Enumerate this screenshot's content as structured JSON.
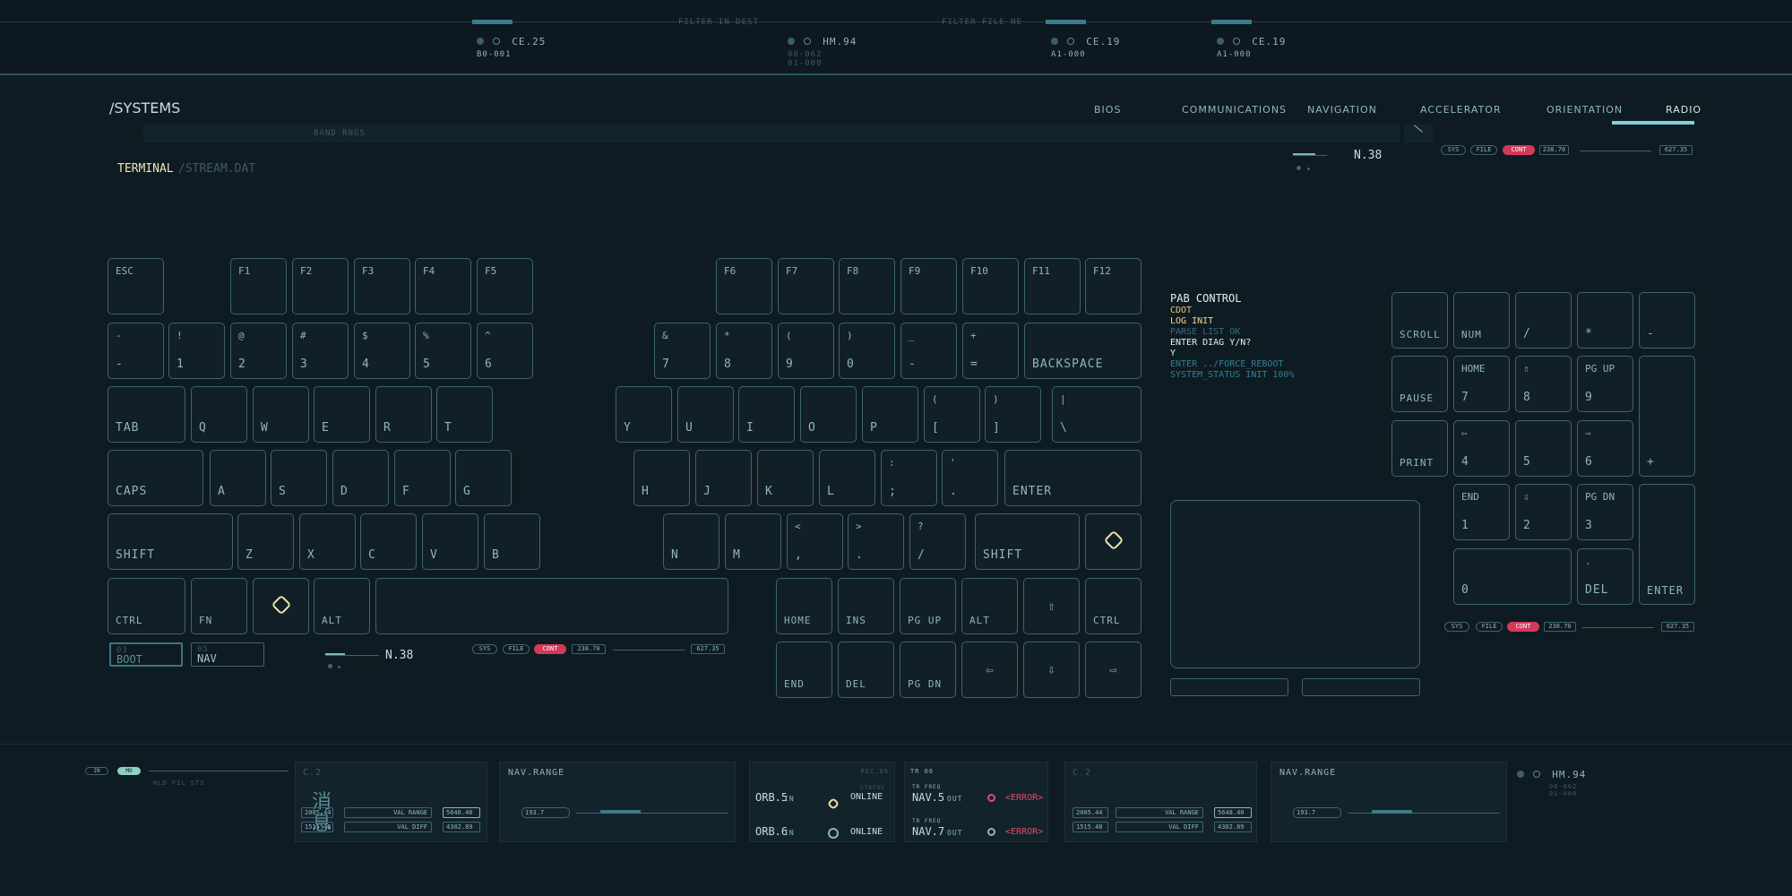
{
  "header": {
    "filter1": "FILTER IN DEST",
    "filter2": "FILTER FILE NE",
    "readouts": [
      {
        "label": "CE.25",
        "sub1": "B0-001",
        "sub2": ""
      },
      {
        "label": "HM.94",
        "sub1": "00-062",
        "sub2": "01-000"
      },
      {
        "label": "CE.19",
        "sub1": "A1-000",
        "sub2": ""
      },
      {
        "label": "CE.19",
        "sub1": "A1-000",
        "sub2": ""
      }
    ]
  },
  "page": {
    "title": "/SYSTEMS",
    "band": "BAND RNGS",
    "terminal": "TERMINAL",
    "stream": "/STREAM.DAT",
    "level": "N.38"
  },
  "nav": {
    "items": [
      "BIOS",
      "COMMUNICATIONS",
      "NAVIGATION",
      "ACCELERATOR",
      "ORIENTATION",
      "RADIO"
    ]
  },
  "status_pills": {
    "sys": "SYS",
    "file": "FILE",
    "cont": "CONT",
    "v1": "238.70",
    "v2": "627.35"
  },
  "keyboard": {
    "esc": "ESC",
    "fkeys": [
      "F1",
      "F2",
      "F3",
      "F4",
      "F5",
      "F6",
      "F7",
      "F8",
      "F9",
      "F10",
      "F11",
      "F12"
    ],
    "num_row": [
      {
        "top": "-",
        "bottom": "-"
      },
      {
        "top": "!",
        "bottom": "1"
      },
      {
        "top": "@",
        "bottom": "2"
      },
      {
        "top": "#",
        "bottom": "3"
      },
      {
        "top": "$",
        "bottom": "4"
      },
      {
        "top": "%",
        "bottom": "5"
      },
      {
        "top": "^",
        "bottom": "6"
      },
      {
        "top": "&",
        "bottom": "7"
      },
      {
        "top": "*",
        "bottom": "8"
      },
      {
        "top": "(",
        "bottom": "9"
      },
      {
        "top": ")",
        "bottom": "0"
      },
      {
        "top": "_",
        "bottom": "-"
      },
      {
        "top": "+",
        "bottom": "="
      }
    ],
    "backspace": "BACKSPACE",
    "tab": "TAB",
    "row_q": [
      "Q",
      "W",
      "E",
      "R",
      "T",
      "Y",
      "U",
      "I",
      "O",
      "P"
    ],
    "bracket_l": {
      "top": "(",
      "bottom": "["
    },
    "bracket_r": {
      "top": ")",
      "bottom": "]"
    },
    "backslash": {
      "top": "|",
      "bottom": "\\"
    },
    "caps": "CAPS",
    "row_a": [
      "A",
      "S",
      "D",
      "F",
      "G",
      "H",
      "J",
      "K",
      "L"
    ],
    "semi": {
      "top": ":",
      "bottom": ";"
    },
    "quote": {
      "top": "'",
      "bottom": "."
    },
    "enter": "ENTER",
    "shift": "SHIFT",
    "row_z": [
      "Z",
      "X",
      "C",
      "V",
      "B",
      "N",
      "M"
    ],
    "lt": {
      "top": "<",
      "bottom": ","
    },
    "gt": {
      "top": ">",
      "bottom": "."
    },
    "qm": {
      "top": "?",
      "bottom": "/"
    },
    "ctrl": "CTRL",
    "fn": "FN",
    "alt": "ALT",
    "home": "HOME",
    "ins": "INS",
    "pgup": "PG UP",
    "end": "END",
    "del": "DEL",
    "pgdn": "PG DN",
    "arrow_up": "⇧",
    "arrow_down": "⇩",
    "arrow_left": "⇦",
    "arrow_right": "⇨",
    "boot_top": "03",
    "boot": "BOOT",
    "nav_top": "05",
    "nav": "NAV"
  },
  "terminal": {
    "title": "PAB CONTROL",
    "lines": [
      "CDOT",
      "LOG INIT",
      "PARSE LIST OK",
      "ENTER DIAG Y/N?",
      "Y",
      "ENTER ../FORCE_REBOOT",
      "SYSTEM_STATUS INIT 100%"
    ],
    "colors": [
      "#e9c77a",
      "#f0d890",
      "#2f6e7a",
      "#e6eef0",
      "#e6eef0",
      "#2f7f95",
      "#2f7f95"
    ]
  },
  "numpad": {
    "scroll": "SCROLL",
    "num": "NUM",
    "slash": "/",
    "star": "*",
    "minus": "-",
    "pause": "PAUSE",
    "home": "HOME",
    "k7": "7",
    "up": "⇧",
    "k8": "8",
    "pgup": "PG UP",
    "k9": "9",
    "print": "PRINT",
    "left": "⇦",
    "k4": "4",
    "k5": "5",
    "right": "⇨",
    "k6": "6",
    "plus": "+",
    "end": "END",
    "k1": "1",
    "down": "⇩",
    "k2": "2",
    "pgdn": "PG DN",
    "k3": "3",
    "k0": "0",
    "dot": ".",
    "del": "DEL",
    "enter": "ENTER"
  },
  "bottom": {
    "toggle1": "IN",
    "toggle2": "MO",
    "toggle_sub": "HLD FIL STS",
    "c2": "C.2",
    "nav_range": "NAV.RANGE",
    "kanji1": "消",
    "kanji2": "息",
    "v1": "2005.44",
    "v2": "1515.48",
    "v3": "5648.40",
    "v4": "4302.89",
    "lbl1": "VAL RANGE",
    "lbl2": "VAL DIFF",
    "rng": "193.7",
    "rec": "REC.06",
    "trfreq": "TR 06",
    "status": "STATUS",
    "trlbl": "TR FREQ",
    "orb1": "ORB.5",
    "orb2": "ORB.6",
    "online": "ONLINE",
    "in": "IN",
    "navout1": "NAV.5",
    "navout2": "NAV.7",
    "out": "OUT",
    "error": "<ERROR>",
    "hm": "HM.94",
    "hm_sub1": "00-062",
    "hm_sub2": "01-000"
  },
  "colors": {
    "bg": "#0f1b22",
    "accent": "#3b7b8a",
    "alert": "#d23a5a",
    "highlight": "#e9c77a"
  }
}
